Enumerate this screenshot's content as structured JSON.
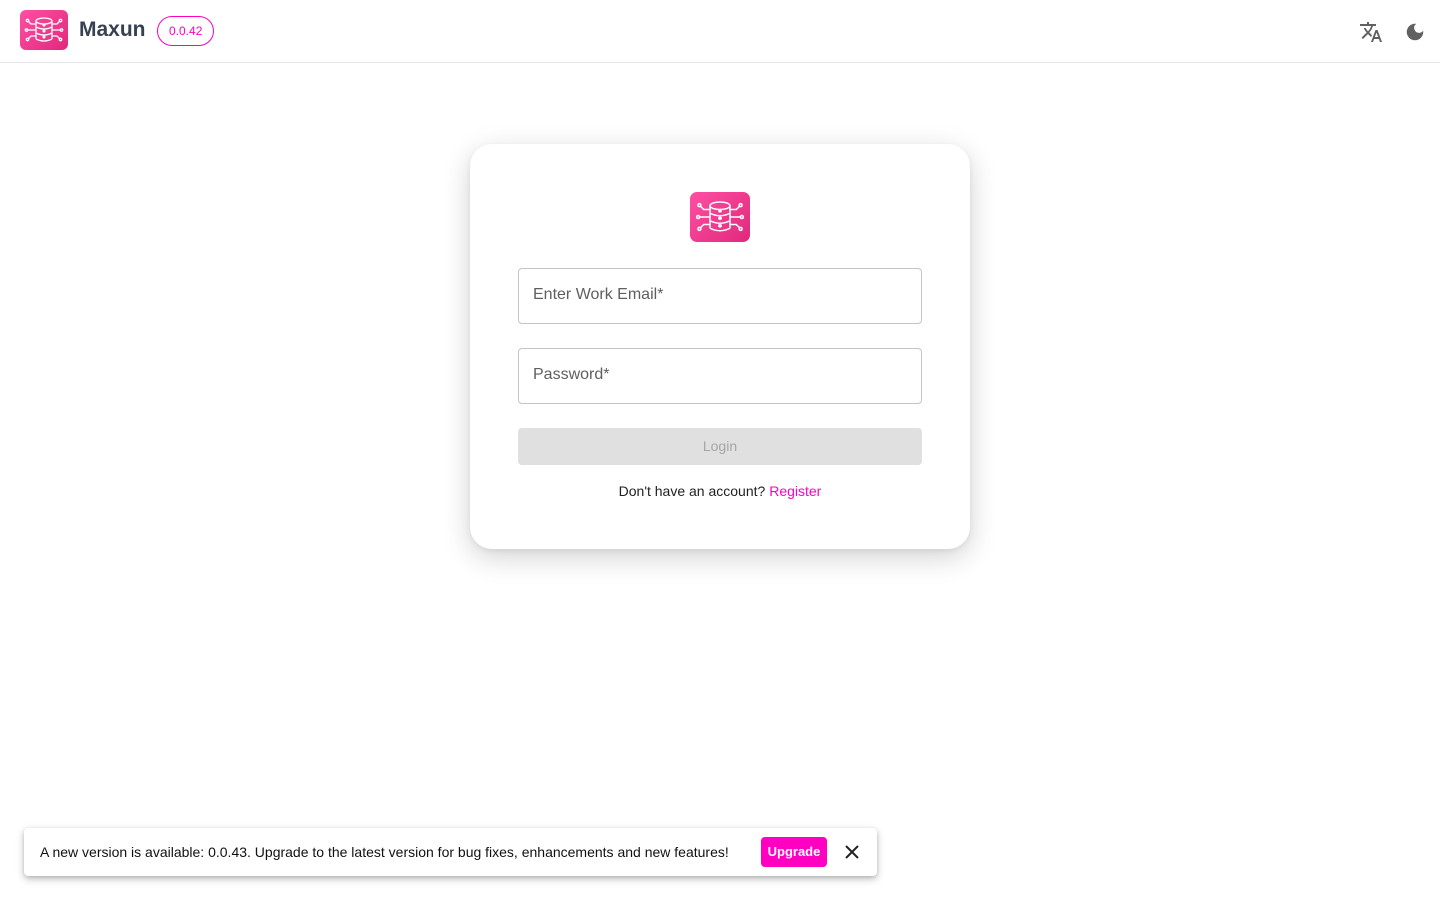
{
  "header": {
    "app_name": "Maxun",
    "version": "0.0.42",
    "logo_icon": "database-circuit-icon",
    "icons": [
      "translate-icon",
      "dark-mode-moon-icon"
    ]
  },
  "login": {
    "logo_icon": "database-circuit-icon",
    "email_label": "Enter Work Email",
    "password_label": "Password",
    "required_mark": "*",
    "login_label": "Login",
    "register_prompt": "Don't have an account?",
    "register_link": "Register"
  },
  "snackbar": {
    "message": "A new version is available: 0.0.43. Upgrade to the latest version for bug fixes, enhancements and new features!",
    "upgrade_label": "Upgrade",
    "close_icon": "close-icon"
  },
  "colors": {
    "accent": "#ff00c3",
    "logo_gradient_start": "#ff4fa3",
    "logo_gradient_end": "#e0297c"
  }
}
